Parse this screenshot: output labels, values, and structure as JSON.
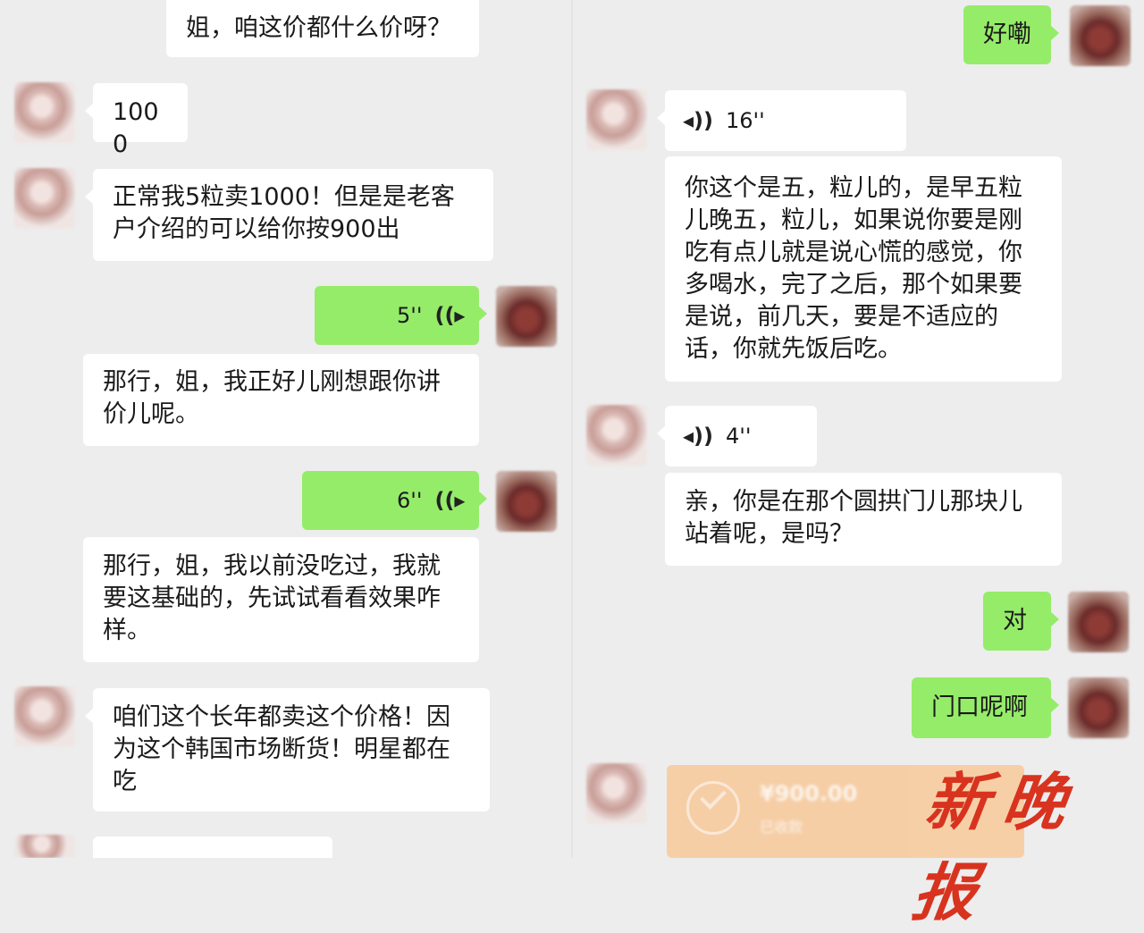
{
  "left_chat": {
    "messages": [
      {
        "sender": "me-text",
        "text": "姐，咱这价都什么价呀？"
      },
      {
        "sender": "her",
        "text": "1000"
      },
      {
        "sender": "her",
        "text": "正常我5粒卖1000！但是是老客户介绍的可以给你按900出"
      },
      {
        "sender": "me-voice",
        "duration": "5''"
      },
      {
        "sender": "me-text",
        "text": "那行，姐，我正好儿刚想跟你讲价儿呢。"
      },
      {
        "sender": "me-voice",
        "duration": "6''"
      },
      {
        "sender": "me-text",
        "text": "那行，姐，我以前没吃过，我就要这基础的，先试试看看效果咋样。"
      },
      {
        "sender": "her",
        "text": "咱们这个长年都卖这个价格！因为这个韩国市场断货！明星都在吃"
      }
    ]
  },
  "right_chat": {
    "messages": [
      {
        "sender": "me",
        "text": "好嘞"
      },
      {
        "sender": "her-voice",
        "duration": "16''"
      },
      {
        "sender": "her-text",
        "text": "你这个是五，粒儿的，是早五粒儿晚五，粒儿，如果说你要是刚吃有点儿就是说心慌的感觉，你多喝水，完了之后，那个如果要是说，前几天，要是不适应的话，你就先饭后吃。"
      },
      {
        "sender": "her-voice",
        "duration": "4''"
      },
      {
        "sender": "her-text",
        "text": "亲，你是在那个圆拱门儿那块儿站着呢，是吗？"
      },
      {
        "sender": "me",
        "text": "对"
      },
      {
        "sender": "me",
        "text": "门口呢啊"
      }
    ],
    "transfer": {
      "amount": "¥900.00",
      "status": "已收款"
    }
  },
  "icons": {
    "voice_in": "◂))",
    "voice_out": "((▸"
  },
  "watermark": "新晚报",
  "colors": {
    "background": "#ededed",
    "bubble_green": "#95ec69",
    "bubble_white": "#ffffff",
    "watermark": "#d8331f"
  }
}
